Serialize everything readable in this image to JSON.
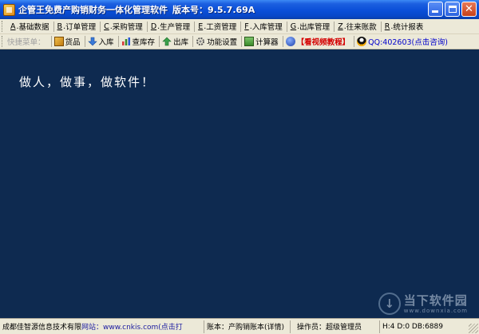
{
  "window": {
    "title": "企管王免费产购销财务一体化管理软件",
    "version_label": "版本号：9.5.7.69A"
  },
  "menu": [
    {
      "key": "A",
      "label": "基础数据"
    },
    {
      "key": "B",
      "label": "订单管理"
    },
    {
      "key": "C",
      "label": "采购管理"
    },
    {
      "key": "D",
      "label": "生产管理"
    },
    {
      "key": "E",
      "label": "工资管理"
    },
    {
      "key": "F",
      "label": "入库管理"
    },
    {
      "key": "G",
      "label": "出库管理"
    },
    {
      "key": "Z",
      "label": "往来账款"
    },
    {
      "key": "R",
      "label": "统计报表"
    }
  ],
  "toolbar": {
    "caption": "快捷菜单：",
    "buttons": [
      {
        "label": "货品",
        "icon": "goods-icon"
      },
      {
        "label": "入库",
        "icon": "arrow-down-icon"
      },
      {
        "label": "查库存",
        "icon": "bar-chart-icon"
      },
      {
        "label": "出库",
        "icon": "arrow-up-icon"
      },
      {
        "label": "功能设置",
        "icon": "gear-icon"
      },
      {
        "label": "计算器",
        "icon": "calculator-icon"
      },
      {
        "label": "【看视频教程】",
        "icon": "video-icon"
      },
      {
        "label": "QQ:402603(点击咨询)",
        "icon": "qq-icon"
      }
    ]
  },
  "workspace": {
    "background": "#0e2a50",
    "slogan": "做人，做事，做软件！",
    "watermark_title": "当下软件园",
    "watermark_url": "www.downxia.com"
  },
  "statusbar": {
    "company_prefix": "成都佳智源信息技术有限",
    "site_label": "网站：",
    "site_link": "www.cnkis.com(点击打",
    "account": "账本：产购销账本(详情)",
    "operator": "操作员：超级管理员",
    "info": "H:4 D:0 DB:6889"
  }
}
